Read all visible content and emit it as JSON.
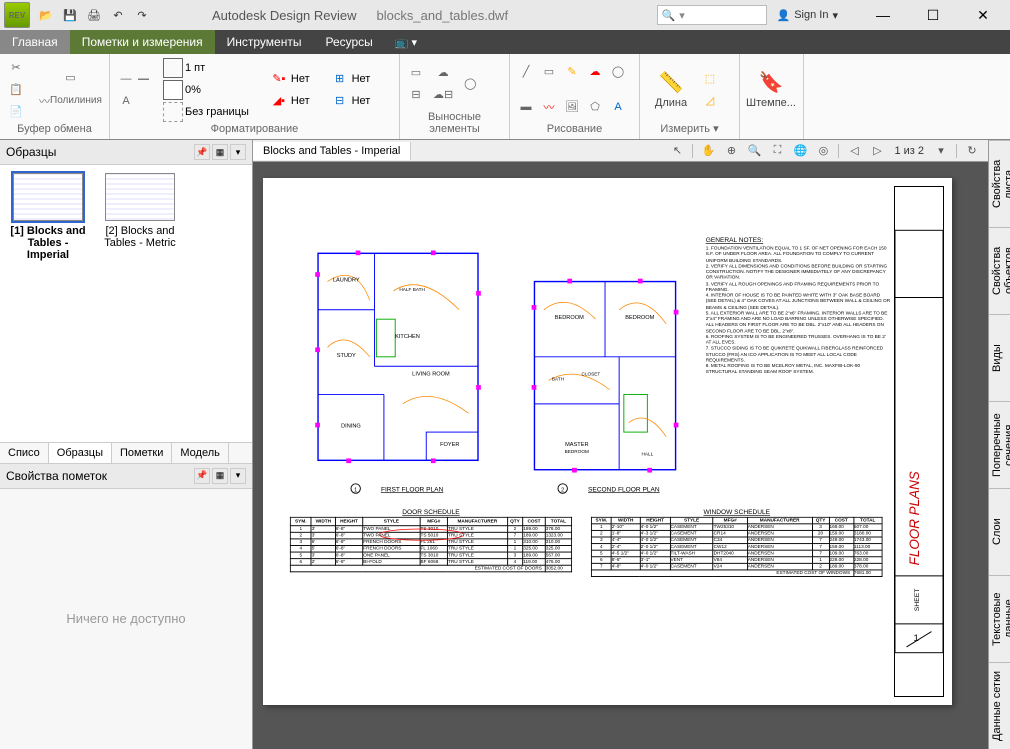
{
  "app": {
    "title": "Autodesk Design Review",
    "file": "blocks_and_tables.dwf",
    "signin": "Sign In",
    "logo": "REV"
  },
  "tabs": {
    "home": "Главная",
    "markup": "Пометки и измерения",
    "tools": "Инструменты",
    "resources": "Ресурсы"
  },
  "ribbon_groups": {
    "clipboard": "Буфер обмена",
    "polyline": "Полилиния",
    "format": "Форматирование",
    "callouts": "Выносные элементы",
    "draw": "Рисование",
    "measure": "Измерить ▾",
    "length": "Длина",
    "stamp": "Штемпе...",
    "none1": "Нет",
    "none2": "Нет",
    "weight": "1 пт",
    "opacity": "0%",
    "noborder": "Без границы"
  },
  "left": {
    "panel_title": "Образцы",
    "tabs": {
      "list": "Списо",
      "thumbs": "Образцы",
      "markups": "Пометки",
      "model": "Модель"
    },
    "prop_title": "Свойства пометок",
    "prop_empty": "Ничего не доступно",
    "thumbs": [
      {
        "label": "[1] Blocks and Tables - Imperial",
        "selected": true
      },
      {
        "label": "[2] Blocks and Tables - Metric",
        "selected": false
      }
    ]
  },
  "doc": {
    "tab": "Blocks and Tables - Imperial",
    "page": "1 из 2"
  },
  "right_tabs": [
    "Свойства листа",
    "Свойства объектов",
    "Виды",
    "Поперечные сечения",
    "Слои",
    "Текстовые данные",
    "Данные сетки"
  ],
  "drawing": {
    "plan1": "FIRST FLOOR PLAN",
    "plan2": "SECOND FLOOR PLAN",
    "rooms1": [
      "LAUNDRY",
      "STUDY",
      "DINING",
      "LIVING ROOM",
      "FOYER",
      "KITCHEN",
      "HALF BATH"
    ],
    "rooms2": [
      "BEDROOM",
      "BEDROOM",
      "BATH",
      "CLOSET",
      "HALL",
      "MASTER BEDROOM"
    ],
    "notes_title": "GENERAL NOTES:",
    "notes": [
      "FOUNDATION VENTILATION EQUAL TO 1 SF. OF NET OPENING FOR EACH 150 S.F. OF UNDER FLOOR AREA. ALL FOUNDATION TO COMPLY TO CURRENT UNIFORM BUILDING STANDARDS.",
      "VERIFY ALL DIMENSIONS AND CONDITIONS BEFORE BUILDING OR STARTING CONSTRUCTION. NOTIFY THE DESIGNER IMMEDIATELY OF ANY DISCREPANCY OR VARIATION.",
      "VERIFY ALL ROUGH OPENINGS AND FRAMING REQUIREMENTS PRIOR TO FRAMING.",
      "INTERIOR OF HOUSE IS TO BE PAINTED WHITE WITH 3\" OAK BASE BOARD (SEE DETAIL) & 4\" OAK COVES AT ALL JUNCTIONS BETWEEN WALL & CEILING OR BEAMS & CEILING (SEE DETAIL).",
      "ALL EXTERIOR WALL ARE TO BE 2\"x6\" FRAMING. INTERIOR WALLS ARE TO BE 2\"x4\" FRAMING AND ARE NO LOAD BARRING UNLESS OTHERWISE SPECIFIED. ALL HEADERS ON FIRST FLOOR ARE TO BE DBL. 2\"x10\" AND ALL HEADERS ON SECOND FLOOR ARE TO BE DBL. 2\"x8\".",
      "ROOFING SYSTEM IS TO BE ENGINEERED TRUSSES. OVERHANG IS TO BE 2' AT ALL EVES.",
      "STUCCO SIDING IS TO BE QUIKRETE QUIKWALL FIBERGLASS REINFORCED STUCCO (FRS) AN ICO APPLICATION IS TO MEET ALL LOCAL CODE REQUIREMENTS.",
      "METAL ROOFING IS TO BE MCELROY METAL, INC. MAXFIB-LOK-90 STRUCTURAL STANDING SEAM ROOF SYSTEM."
    ],
    "door_schedule": {
      "title": "DOOR SCHEDULE",
      "cost_label": "ESTIMATED COST OF DOORS",
      "cost": "3052.00",
      "headers": [
        "SYM.",
        "WIDTH",
        "HEIGHT",
        "STYLE",
        "MFG#",
        "MANUFACTURER",
        "QTY",
        "COST",
        "TOTAL"
      ],
      "rows": [
        [
          "1",
          "3'",
          "6'-8\"",
          "TWO PANEL",
          "TS 3010",
          "TRU STYLE",
          "2",
          "189.00",
          "378.00"
        ],
        [
          "2",
          "3'",
          "6'-8\"",
          "TWO PANEL",
          "TS 5010",
          "TRU STYLE",
          "7",
          "189.00",
          "1323.00"
        ],
        [
          "3",
          "6'",
          "6'-8\"",
          "FRENCH DOORS",
          "FL 261",
          "TRU STYLE",
          "1",
          "310.00",
          "310.00"
        ],
        [
          "4",
          "5'",
          "6'-8\"",
          "FRENCH DOORS",
          "FL 1060",
          "TRU STYLE",
          "1",
          "325.00",
          "325.00"
        ],
        [
          "5",
          "3'",
          "6'-8\"",
          "ONE PANEL",
          "TS 3010",
          "TRU STYLE",
          "3",
          "189.00",
          "567.00"
        ],
        [
          "6",
          "2'",
          "6'-8\"",
          "BI-FOLD",
          "BF 6068",
          "TRU STYLE",
          "4",
          "119.00",
          "476.00"
        ]
      ]
    },
    "window_schedule": {
      "title": "WINDOW SCHEDULE",
      "cost_label": "ESTIMATED COST OF WINDOWS",
      "cost": "7681.00",
      "headers": [
        "SYM.",
        "WIDTH",
        "HEIGHT",
        "STYLE",
        "MFG#",
        "MANUFACTURER",
        "QTY",
        "COST",
        "TOTAL"
      ],
      "rows": [
        [
          "1",
          "2'-10\"",
          "4'-0 1/2\"",
          "CASEMENT",
          "TW25310",
          "ANDERSEN",
          "3",
          "169.00",
          "507.00"
        ],
        [
          "2",
          "1'-8\"",
          "4'-3 1/2\"",
          "CASEMENT",
          "CR14",
          "ANDERSEN",
          "20",
          "159.00",
          "3180.00"
        ],
        [
          "3",
          "4'-4\"",
          "4'-0 1/2\"",
          "CASEMENT",
          "C34",
          "ANDERSEN",
          "7",
          "249.00",
          "1743.00"
        ],
        [
          "4",
          "2'-4\"",
          "2'-0 1/2\"",
          "CASEMENT",
          "CW12",
          "ANDERSEN",
          "7",
          "159.00",
          "1113.00"
        ],
        [
          "5",
          "4'-5 1/2\"",
          "4'-0 1/2\"",
          "TILT-WASH",
          "DHT2040",
          "ANDERSEN",
          "7",
          "109.00",
          "763.00"
        ],
        [
          "6",
          "8'-6\"",
          "3'-1\"",
          "VENT",
          "V84",
          "ANDERSEN",
          "1",
          "228.00",
          "228.00"
        ],
        [
          "7",
          "4'-8\"",
          "4'-0 1/2\"",
          "CASEMENT",
          "V24",
          "ANDERSEN",
          "2",
          "189.00",
          "378.00"
        ]
      ]
    }
  }
}
